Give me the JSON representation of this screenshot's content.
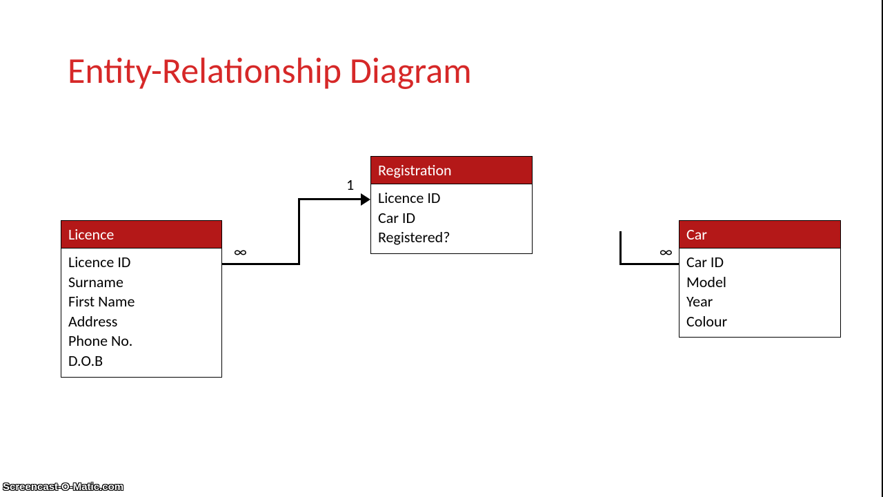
{
  "title": "Entity-Relationship Diagram",
  "entities": {
    "licence": {
      "name": "Licence",
      "fields": [
        "Licence ID",
        "Surname",
        "First Name",
        "Address",
        "Phone No.",
        "D.O.B"
      ]
    },
    "registration": {
      "name": "Registration",
      "fields": [
        "Licence ID",
        "Car ID",
        "Registered?"
      ]
    },
    "car": {
      "name": "Car",
      "fields": [
        "Car ID",
        "Model",
        "Year",
        "Colour"
      ]
    }
  },
  "labels": {
    "infinity1": "∞",
    "one": "1",
    "infinity2": "∞"
  },
  "watermark": "Screencast-O-Matic.com"
}
